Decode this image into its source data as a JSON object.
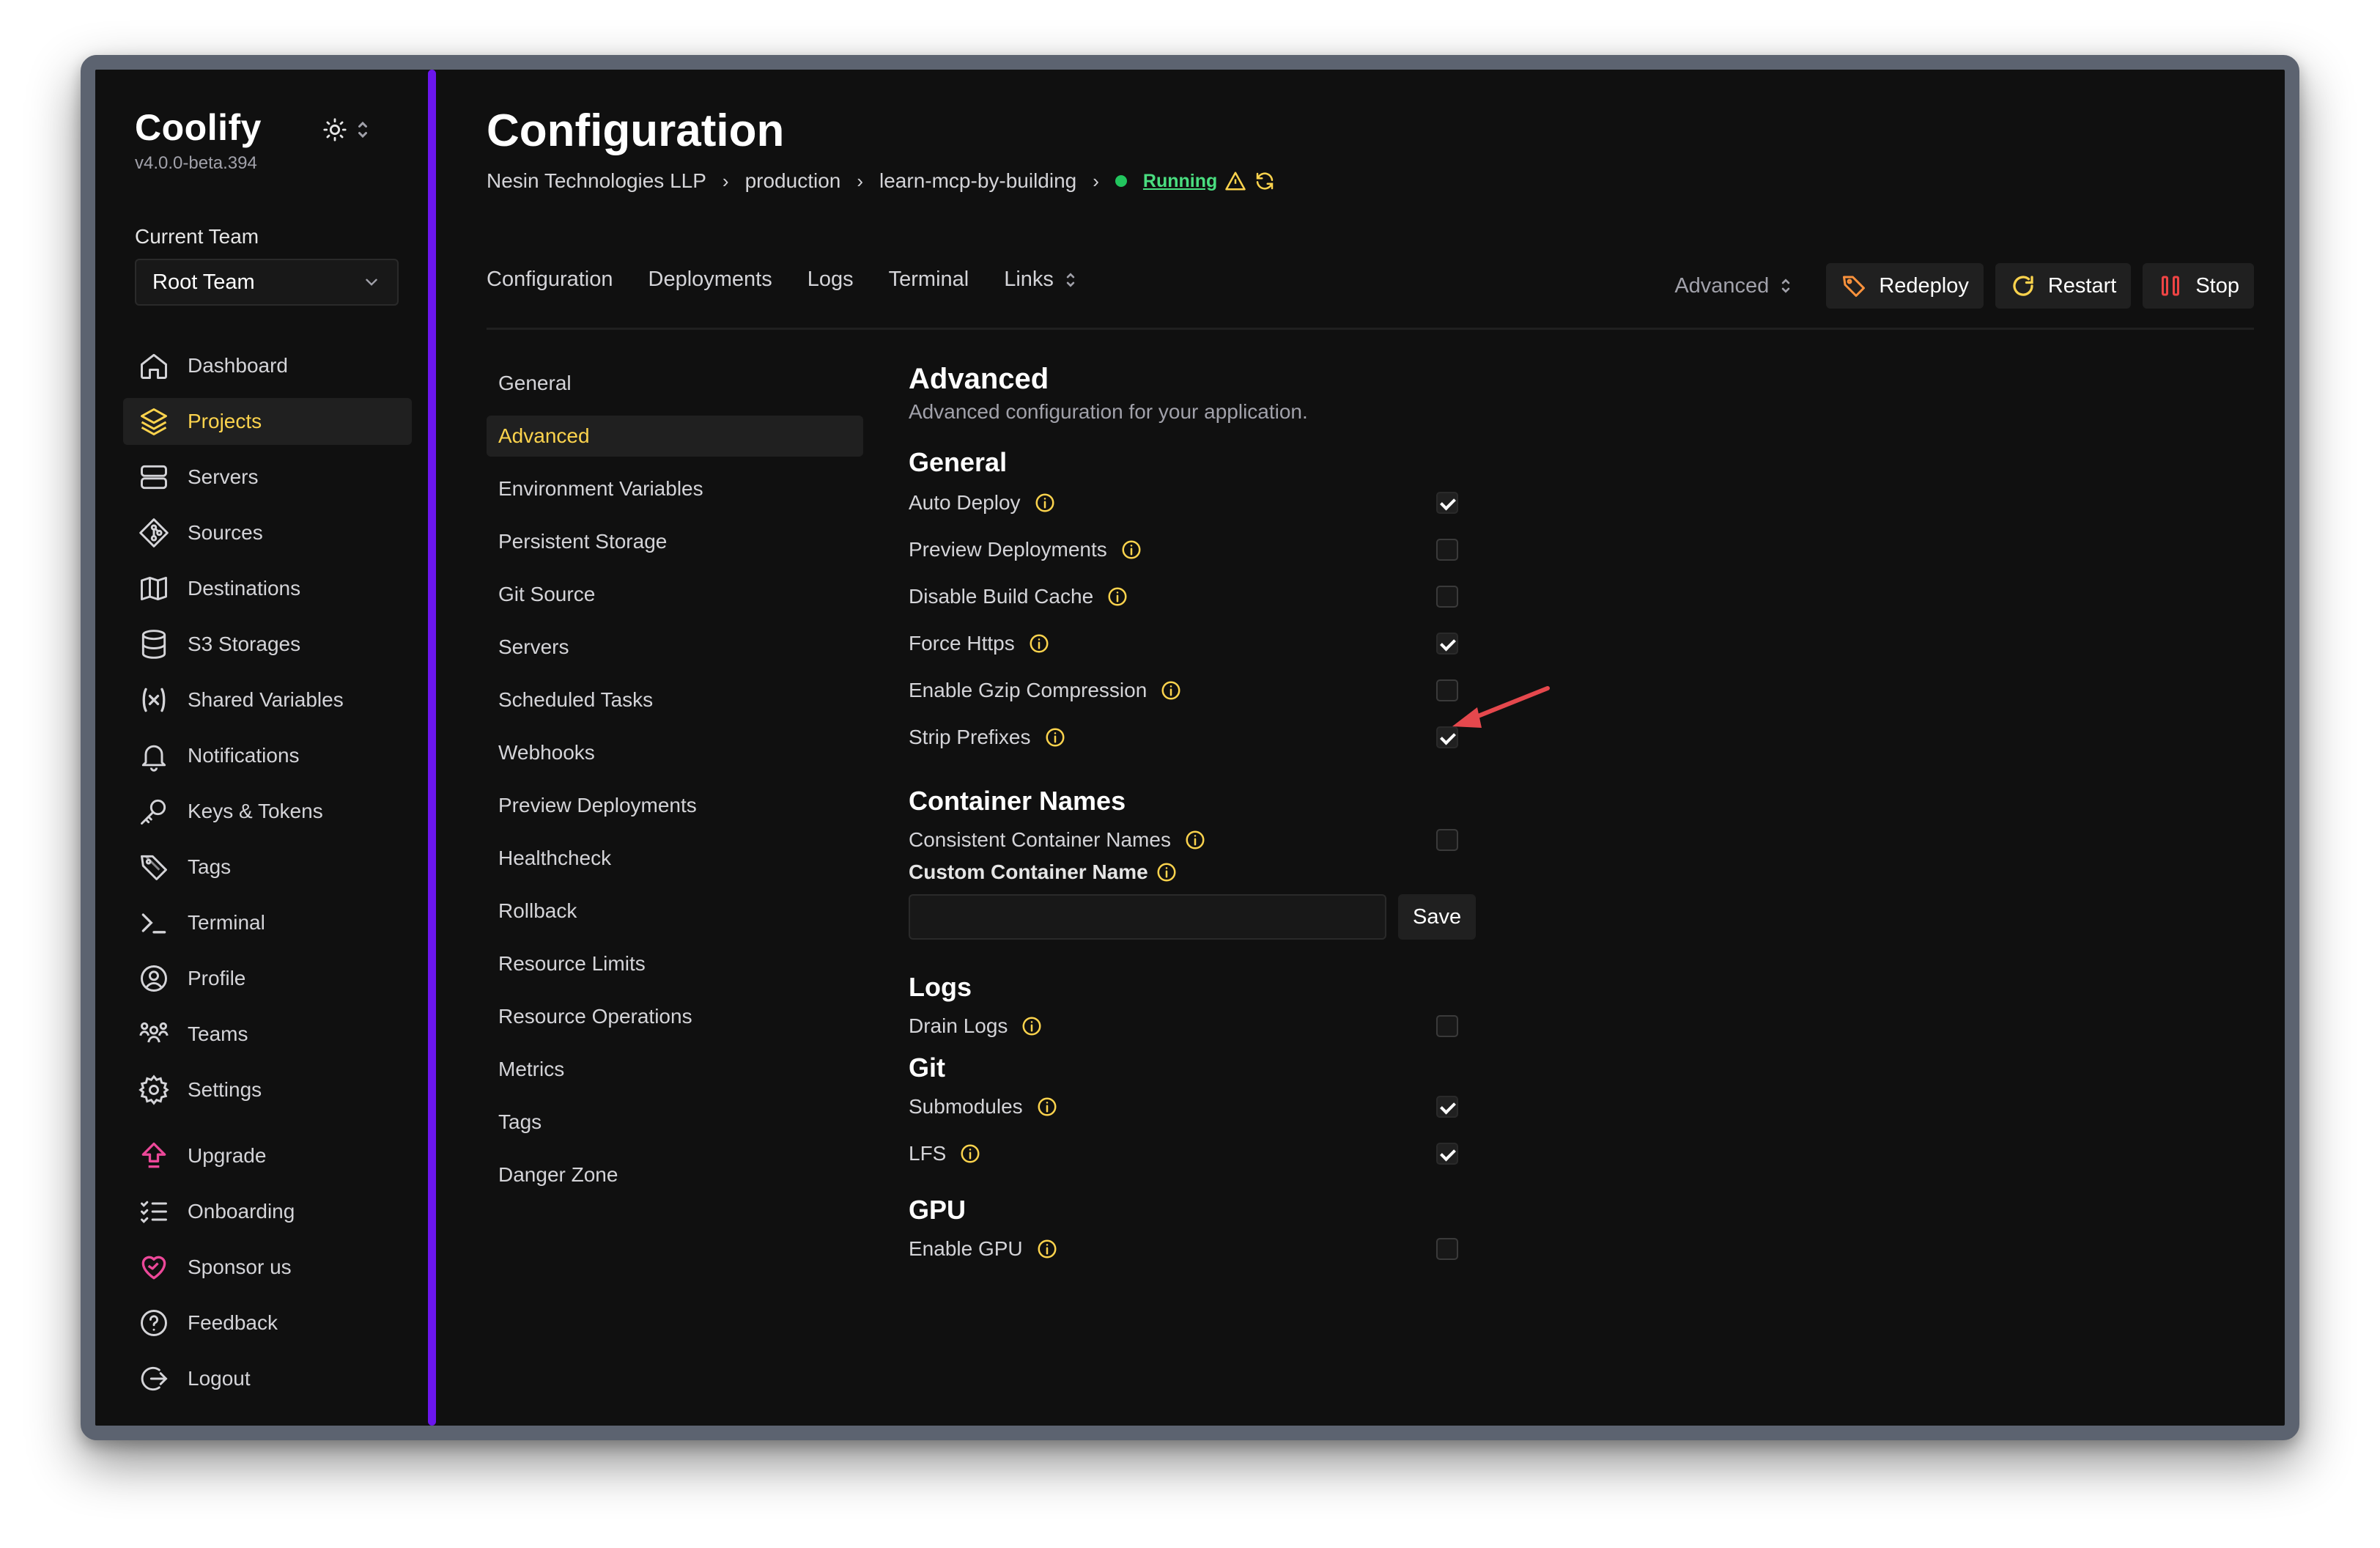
{
  "sidebar": {
    "app_title": "Coolify",
    "version": "v4.0.0-beta.394",
    "team_label": "Current Team",
    "team_value": "Root Team",
    "items": [
      {
        "label": "Dashboard",
        "icon": "home-icon"
      },
      {
        "label": "Projects",
        "icon": "layers-icon",
        "active": true
      },
      {
        "label": "Servers",
        "icon": "server-icon"
      },
      {
        "label": "Sources",
        "icon": "git-icon"
      },
      {
        "label": "Destinations",
        "icon": "map-icon"
      },
      {
        "label": "S3 Storages",
        "icon": "database-icon"
      },
      {
        "label": "Shared Variables",
        "icon": "variable-icon"
      },
      {
        "label": "Notifications",
        "icon": "bell-icon"
      },
      {
        "label": "Keys & Tokens",
        "icon": "key-icon"
      },
      {
        "label": "Tags",
        "icon": "tag-icon"
      },
      {
        "label": "Terminal",
        "icon": "terminal-icon"
      },
      {
        "label": "Profile",
        "icon": "user-circle-icon"
      },
      {
        "label": "Teams",
        "icon": "users-icon"
      },
      {
        "label": "Settings",
        "icon": "gear-icon"
      }
    ],
    "extra_items": [
      {
        "label": "Upgrade",
        "icon": "upgrade-icon"
      },
      {
        "label": "Onboarding",
        "icon": "list-check-icon"
      },
      {
        "label": "Sponsor us",
        "icon": "heart-icon"
      },
      {
        "label": "Feedback",
        "icon": "help-circle-icon"
      },
      {
        "label": "Logout",
        "icon": "logout-icon"
      }
    ]
  },
  "header": {
    "title": "Configuration",
    "breadcrumb": [
      "Nesin Technologies LLP",
      "production",
      "learn-mcp-by-building"
    ],
    "status": "Running"
  },
  "topnav": {
    "tabs": [
      "Configuration",
      "Deployments",
      "Logs",
      "Terminal"
    ],
    "links_label": "Links",
    "advanced_label": "Advanced",
    "redeploy": "Redeploy",
    "restart": "Restart",
    "stop": "Stop"
  },
  "subnav": [
    "General",
    "Advanced",
    "Environment Variables",
    "Persistent Storage",
    "Git Source",
    "Servers",
    "Scheduled Tasks",
    "Webhooks",
    "Preview Deployments",
    "Healthcheck",
    "Rollback",
    "Resource Limits",
    "Resource Operations",
    "Metrics",
    "Tags",
    "Danger Zone"
  ],
  "subnav_active": "Advanced",
  "content": {
    "title": "Advanced",
    "description": "Advanced configuration for your application.",
    "general": {
      "title": "General",
      "options": [
        {
          "label": "Auto Deploy",
          "checked": true
        },
        {
          "label": "Preview Deployments",
          "checked": false
        },
        {
          "label": "Disable Build Cache",
          "checked": false
        },
        {
          "label": "Force Https",
          "checked": true
        },
        {
          "label": "Enable Gzip Compression",
          "checked": false
        },
        {
          "label": "Strip Prefixes",
          "checked": true
        }
      ]
    },
    "container": {
      "title": "Container Names",
      "consistent_label": "Consistent Container Names",
      "consistent_checked": false,
      "custom_label": "Custom Container Name",
      "custom_value": "",
      "save_label": "Save"
    },
    "logs": {
      "title": "Logs",
      "drain_label": "Drain Logs",
      "drain_checked": false
    },
    "git": {
      "title": "Git",
      "submodules_label": "Submodules",
      "submodules_checked": true,
      "lfs_label": "LFS",
      "lfs_checked": true
    },
    "gpu": {
      "title": "GPU",
      "enable_label": "Enable GPU",
      "enable_checked": false
    }
  },
  "colors": {
    "accent": "#fcd34d",
    "rail": "#6b16ed",
    "status_green": "#4ade80",
    "arrow": "#e5484d",
    "info_icon": "#fcd34d"
  }
}
